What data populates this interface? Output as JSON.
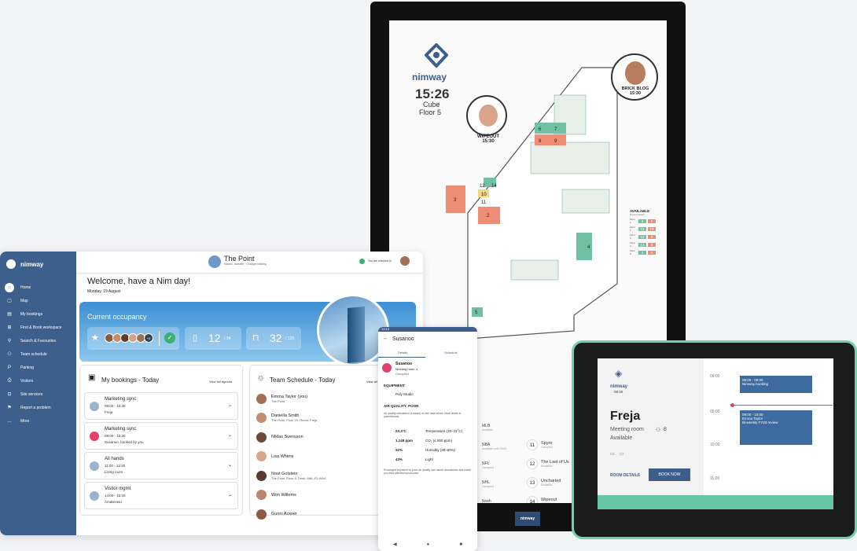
{
  "kiosk": {
    "brand": "nimway",
    "time": "15:26",
    "location": "Cube",
    "floor": "Floor 5",
    "bubble1": {
      "name": "WIPEOUT",
      "time": "15:30"
    },
    "bubble2": {
      "name": "BRICK BLOG",
      "time": "15:30"
    },
    "available": {
      "title": "AVAILABLE",
      "sub": "Rooms  Desks",
      "rows": [
        {
          "floor": "Floor 1",
          "rooms": "3",
          "desks": "0"
        },
        {
          "floor": "Floor 2",
          "rooms": "12",
          "desks": "10"
        },
        {
          "floor": "Floor 3",
          "rooms": "14",
          "desks": "0"
        },
        {
          "floor": "Floor 4",
          "rooms": "13",
          "desks": "0"
        },
        {
          "floor": "Floor 5",
          "rooms": "1",
          "desks": "4"
        }
      ]
    },
    "rooms": [
      "6",
      "7",
      "8",
      "9",
      "12",
      "14",
      "10",
      "11",
      "2",
      "3",
      "4",
      "5",
      "1"
    ],
    "footer_brand": "nimway",
    "list_left": [
      {
        "name": "MLB",
        "status": "Available"
      },
      {
        "name": "NBA",
        "status": "Available until 15:00"
      },
      {
        "name": "NFL",
        "status": "Occupied"
      },
      {
        "name": "NHL",
        "status": "Occupied"
      },
      {
        "name": "Nosh",
        "status": "Booked until 08:00 Currently empty"
      }
    ],
    "list_right": [
      {
        "num": "11",
        "name": "Spyro",
        "status": "Occupied"
      },
      {
        "num": "12",
        "name": "The Last of Us",
        "status": "Available"
      },
      {
        "num": "13",
        "name": "Uncharted",
        "status": "Available"
      },
      {
        "num": "14",
        "name": "Wipeout",
        "status": "Available"
      }
    ]
  },
  "tablet": {
    "brand": "nimway",
    "nav": [
      {
        "icon": "⌂",
        "label": "Home"
      },
      {
        "icon": "▢",
        "label": "Map"
      },
      {
        "icon": "▤",
        "label": "My bookings"
      },
      {
        "icon": "⊞",
        "label": "Find & Book workspace"
      },
      {
        "icon": "⚲",
        "label": "Search & Favourites"
      },
      {
        "icon": "⚇",
        "label": "Team schedule"
      },
      {
        "icon": "P",
        "label": "Parking"
      },
      {
        "icon": "⎙",
        "label": "Visitors"
      },
      {
        "icon": "⊡",
        "label": "Site services"
      },
      {
        "icon": "⚑",
        "label": "Report a problem"
      },
      {
        "icon": "…",
        "label": "More"
      }
    ],
    "building": "The Point",
    "building_sub": "Madrid, Sweden · Change building",
    "checked_in": "You are checked in",
    "welcome": "Welcome, have a Nim day!",
    "date": "Monday, 19 August",
    "occupancy": {
      "title": "Current occupancy",
      "count_more": "+3",
      "rooms": "12",
      "rooms_total": "/ 34",
      "desks": "32",
      "desks_total": "/ 120"
    },
    "bookings_title": "My bookings - Today",
    "view_all": "View full agenda",
    "bookings": [
      {
        "title": "Marketing sync",
        "time": "09:00 - 10:30",
        "place": "Freja"
      },
      {
        "title": "Marketing sync",
        "time": "09:00 - 10:30",
        "place": "Susanoo, booked by you"
      },
      {
        "title": "All hands",
        "time": "11:00 - 12:30",
        "place": "Living room"
      },
      {
        "title": "Visitor mgmt",
        "time": "14:00 - 15:00",
        "place": "Amaterasu"
      }
    ],
    "team_title": "Team Schedule - Today",
    "team_view_all": "View all",
    "team": [
      {
        "name": "Emma Taylor (you)",
        "sub": "The Point"
      },
      {
        "name": "Daniella Smith",
        "sub": "The Point, Floor 23, Room: Freja"
      },
      {
        "name": "Niklas Svensson",
        "sub": ""
      },
      {
        "name": "Lisa Whims",
        "sub": ""
      },
      {
        "name": "Nout Golstein",
        "sub": "The Point, Floor 5, Desk: MAL-F5-W04"
      },
      {
        "name": "Wim Willems",
        "sub": ""
      },
      {
        "name": "Gunni Ackner",
        "sub": ""
      }
    ]
  },
  "phone": {
    "status_time": "13:15",
    "title": "Susanoo",
    "tabs": [
      "Details",
      "Schedule"
    ],
    "room_name": "Susanoo",
    "room_type": "Meeting room",
    "capacity": "4",
    "room_status": "Occupied",
    "equipment_title": "EQUIPMENT",
    "equipment": "Poly Studio",
    "aq_title": "AIR QUALITY: POOR",
    "aq_desc": "Air quality calculation is based on the data below. Ideal levels in parentheses.",
    "aq": [
      {
        "value": "23.3°C",
        "label": "Temperature (18–23°C)"
      },
      {
        "value": "1,148 ppm",
        "label": "CO₂ (≤ 850 ppm)"
      },
      {
        "value": "32%",
        "label": "Humidity (30–60%)"
      },
      {
        "value": "43%",
        "label": "Light"
      }
    ],
    "aq_note": "Prolonged exposure to poor air quality can cause drowsiness and make you less attentive/productive."
  },
  "room": {
    "brand": "nimway",
    "time": "08:40",
    "name": "Freja",
    "type": "Meeting room",
    "capacity": "8",
    "status": "Available",
    "details": "ROOM DETAILS",
    "book": "BOOK NOW",
    "times": [
      "09:00",
      "09:00",
      "10:00",
      "11:00"
    ],
    "events": [
      {
        "time": "08:00 - 09:00",
        "title": "Nimway booking"
      },
      {
        "time": "09:00 - 10:00",
        "title": "Emma Taylor",
        "sub": "Bi-weekly FY23 review"
      }
    ]
  }
}
